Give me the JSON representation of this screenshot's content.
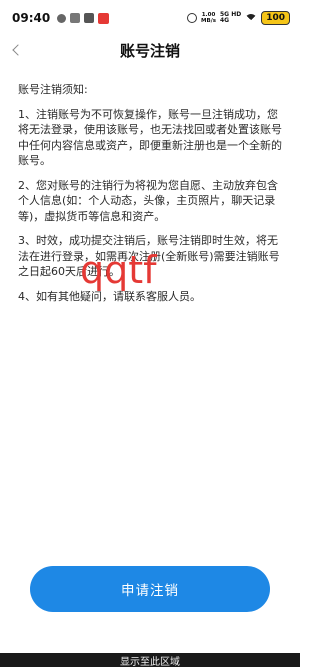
{
  "status_bar": {
    "time": "09:40",
    "net_speed_value": "1.00",
    "net_speed_unit": "MB/s",
    "network_line1": "5G HD",
    "network_line2": "4G",
    "battery": "100"
  },
  "nav": {
    "title": "账号注销"
  },
  "notice": {
    "heading": "账号注销须知:",
    "items": [
      "1、注销账号为不可恢复操作，账号一旦注销成功，您将无法登录，使用该账号，也无法找回或者处置该账号中任何内容信息或资产，即便重新注册也是一个全新的账号。",
      "2、您对账号的注销行为将视为您自愿、主动放弃包含个人信息(如：个人动态，头像，主页照片，聊天记录等)，虚拟货币等信息和资产。",
      "3、时效，成功提交注销后，账号注销即时生效，将无法在进行登录，如需再次注册(全新账号)需要注销账号之日起60天后进行。",
      "4、如有其他疑问，请联系客服人员。"
    ]
  },
  "watermark": "qqtf",
  "apply_button": "申请注销",
  "bottom_bar": "显示至此区域",
  "colors": {
    "accent": "#1e88e5",
    "watermark": "#e53935"
  }
}
